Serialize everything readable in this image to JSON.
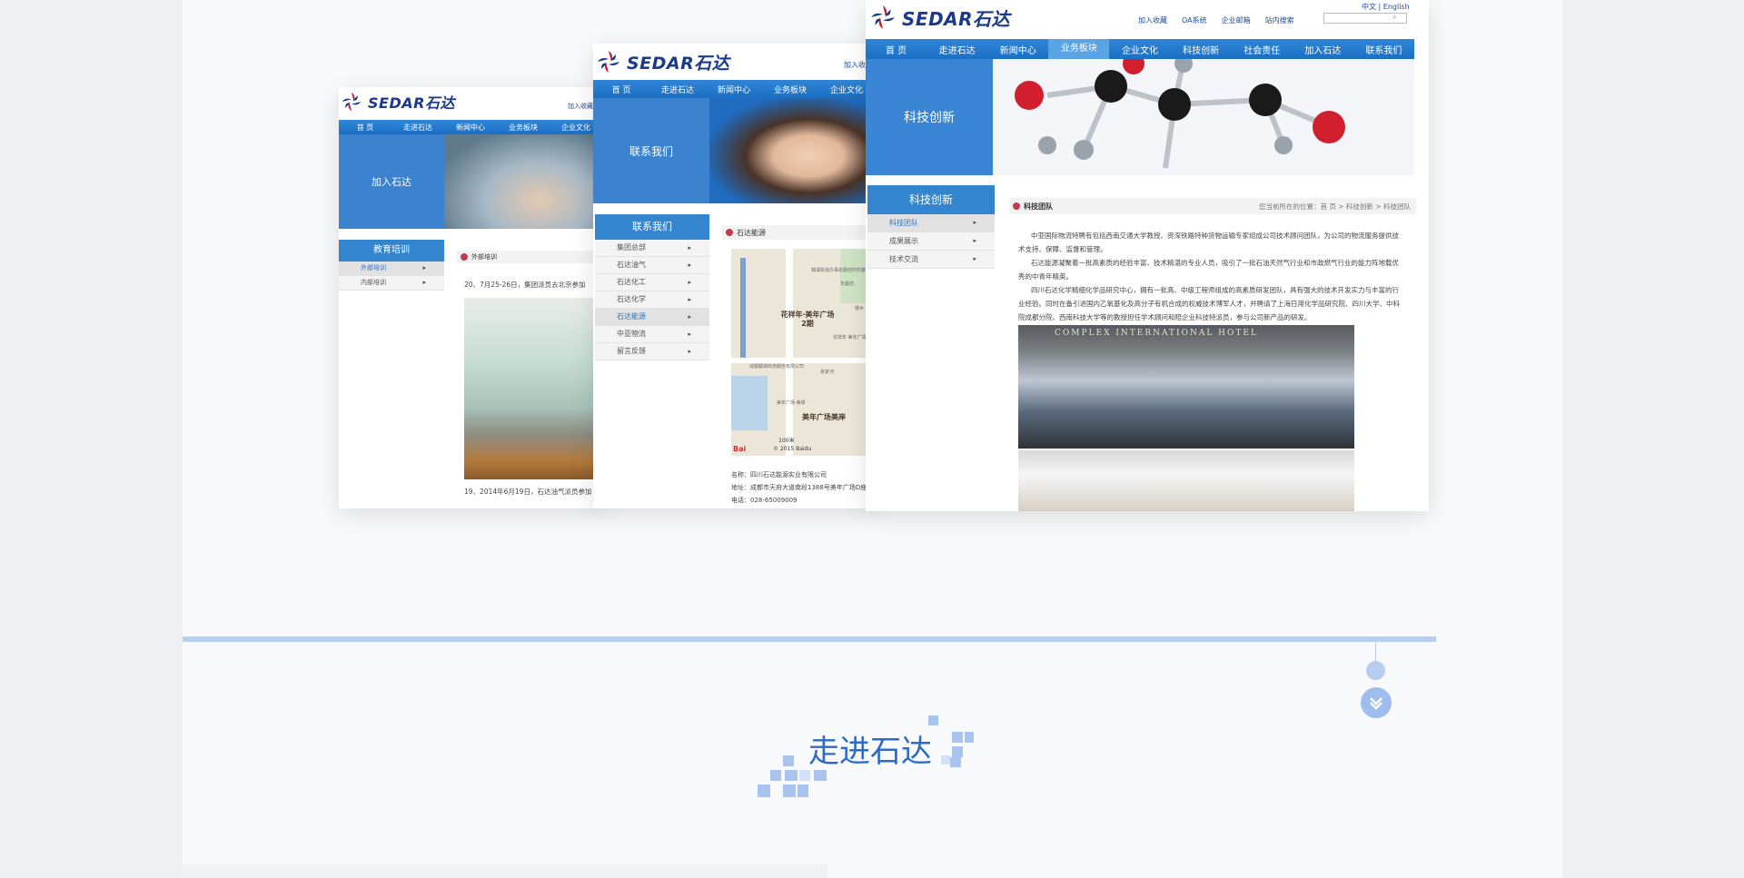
{
  "brand": {
    "logo_text": "SEDAR石达"
  },
  "screen_left": {
    "toplink": "加入收藏",
    "nav": [
      "首 页",
      "走进石达",
      "新闻中心",
      "业务板块",
      "企业文化"
    ],
    "banner_label": "加入石达",
    "sidebar_title": "教育培训",
    "sidebar_items": [
      "外部培训",
      "内部培训"
    ],
    "crumb_title": "外部培训",
    "paragraph_1": "20、7月25-26日，集团派员去北京参加",
    "paragraph_2": "19、2014年6月19日，石达油气派员参加"
  },
  "screen_middle": {
    "toplink": "加入收",
    "nav": [
      "首 页",
      "走进石达",
      "新闻中心",
      "业务板块",
      "企业文化"
    ],
    "banner_label": "联系我们",
    "sidebar_title": "联系我们",
    "sidebar_items": [
      "集团总部",
      "石达油气",
      "石达化工",
      "石达化学",
      "石达能源",
      "中亚物流",
      "留言反馈"
    ],
    "crumb_title": "石达能源",
    "map": {
      "label_1": "花祥年·美年广场2期",
      "label_2": "美年广场美岸",
      "scale": "100米",
      "copyright": "© 2015 Baidu",
      "baidu": "Bai",
      "street_1": "锦溪街道办事处勤俭村村委会",
      "street_2": "成都都城商务服务有限公司",
      "street_3": "华晨仿",
      "street_4": "张家河",
      "street_5": "美年广场·美岸",
      "street_6": "花祥年·美年广场",
      "street_7": "楼木"
    },
    "contact_name": "名称：四川石达能源实业有限公司",
    "contact_address": "地址：成都市天府大道南段1388号美年广场D座",
    "contact_phone": "电话：028-65009009"
  },
  "screen_right": {
    "lang": "中文 | English",
    "toplinks": [
      "加入收藏",
      "OA系统",
      "企业邮箱",
      "站内搜索"
    ],
    "nav": [
      "首 页",
      "走进石达",
      "新闻中心",
      "业务板块",
      "企业文化",
      "科技创新",
      "社会责任",
      "加入石达",
      "联系我们"
    ],
    "nav_active_index": 3,
    "banner_label": "科技创新",
    "sidebar_title": "科技创新",
    "sidebar_items": [
      "科技团队",
      "成果展示",
      "技术交流"
    ],
    "crumb_title": "科技团队",
    "crumb_path": "您当前所在的位置：首 页 > 科技创新 > 科技团队",
    "body": [
      "中亚国际物流特聘有包括西南交通大学教授、资深铁路特种货物运输专家组成公司技术顾问团队，为公司的物流服务提供技术支持、保障、监督和管理。",
      "石达能源凝聚着一批高素质的经验丰富、技术精湛的专业人员，吸引了一批石油天然气行业和市政燃气行业的能力阵地载优秀的中青年精英。",
      "四川石达化学精细化学品研究中心，拥有一批高、中级工程师组成的高素质研发团队，具有强大的技术开发实力与丰富的行业经验。同时在备引进国内乙氧基化及高分子有机合成的权威技术博军人才，并聘请了上海日用化学品研究院、四川大学、中科院成都分院、西南科技大学等的教授担任学术顾问和陪企业科技特派员，参与公司新产品的研发。"
    ],
    "photo_sign": "COMPLEX INTERNATIONAL HOTEL"
  },
  "section": {
    "title": "走进石达"
  },
  "colors": {
    "nav": "#1c6fc4",
    "accent": "#3385d0",
    "title": "#2d6bc4",
    "divider": "#b8cff0"
  }
}
